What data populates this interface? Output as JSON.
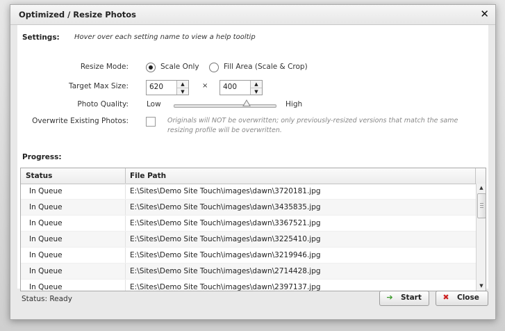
{
  "dialog": {
    "title": "Optimized / Resize Photos",
    "close_icon": "close-icon"
  },
  "settings": {
    "label": "Settings:",
    "hint": "Hover over each setting name to view a help tooltip",
    "resize_mode": {
      "label": "Resize Mode:",
      "options": [
        "Scale Only",
        "Fill Area (Scale & Crop)"
      ],
      "selected": "Scale Only"
    },
    "target_size": {
      "label": "Target Max Size:",
      "width": "620",
      "height": "400",
      "separator": "×"
    },
    "photo_quality": {
      "label": "Photo Quality:",
      "low": "Low",
      "high": "High",
      "level": 0.72
    },
    "overwrite": {
      "label": "Overwrite Existing Photos:",
      "checked": false,
      "note": "Originals will NOT be overwritten; only previously-resized versions that match the same resizing profile will be overwritten."
    }
  },
  "progress": {
    "label": "Progress:",
    "columns": [
      "Status",
      "File Path"
    ],
    "rows": [
      {
        "status": "In Queue",
        "path": "E:\\Sites\\Demo Site Touch\\images\\dawn\\3720181.jpg"
      },
      {
        "status": "In Queue",
        "path": "E:\\Sites\\Demo Site Touch\\images\\dawn\\3435835.jpg"
      },
      {
        "status": "In Queue",
        "path": "E:\\Sites\\Demo Site Touch\\images\\dawn\\3367521.jpg"
      },
      {
        "status": "In Queue",
        "path": "E:\\Sites\\Demo Site Touch\\images\\dawn\\3225410.jpg"
      },
      {
        "status": "In Queue",
        "path": "E:\\Sites\\Demo Site Touch\\images\\dawn\\3219946.jpg"
      },
      {
        "status": "In Queue",
        "path": "E:\\Sites\\Demo Site Touch\\images\\dawn\\2714428.jpg"
      },
      {
        "status": "In Queue",
        "path": "E:\\Sites\\Demo Site Touch\\images\\dawn\\2397137.jpg"
      }
    ]
  },
  "footer": {
    "status": "Status: Ready",
    "start_label": "Start",
    "close_label": "Close"
  },
  "colors": {
    "start_icon": "#3a9a2a",
    "close_icon": "#cc2222"
  }
}
